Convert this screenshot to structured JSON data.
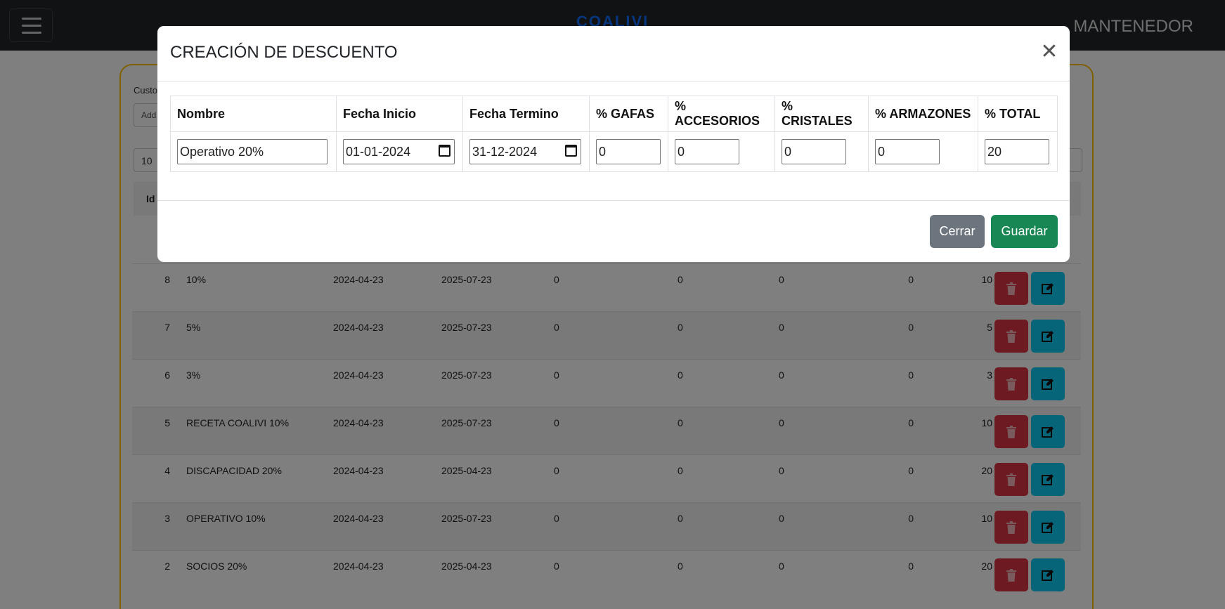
{
  "navbar": {
    "brand": "COALIVI",
    "right_label": "MANTENEDOR"
  },
  "card": {
    "label": "Custo",
    "add_label": "Add",
    "page_length": "10",
    "id_header": "Id"
  },
  "rows": [
    {
      "id": "8",
      "name": "10%",
      "inicio": "2024-04-23",
      "termino": "2025-07-23",
      "gafas": "0",
      "accesorios": "0",
      "cristales": "0",
      "armazones": "0",
      "total": "10"
    },
    {
      "id": "7",
      "name": "5%",
      "inicio": "2024-04-23",
      "termino": "2025-07-23",
      "gafas": "0",
      "accesorios": "0",
      "cristales": "0",
      "armazones": "0",
      "total": "5"
    },
    {
      "id": "6",
      "name": "3%",
      "inicio": "2024-04-23",
      "termino": "2025-07-23",
      "gafas": "0",
      "accesorios": "0",
      "cristales": "0",
      "armazones": "0",
      "total": "3"
    },
    {
      "id": "5",
      "name": "RECETA COALIVI 10%",
      "inicio": "2024-04-23",
      "termino": "2025-07-23",
      "gafas": "0",
      "accesorios": "0",
      "cristales": "0",
      "armazones": "0",
      "total": "10"
    },
    {
      "id": "4",
      "name": "DISCAPACIDAD 20%",
      "inicio": "2024-04-23",
      "termino": "2025-04-23",
      "gafas": "0",
      "accesorios": "0",
      "cristales": "0",
      "armazones": "0",
      "total": "20"
    },
    {
      "id": "3",
      "name": "OPERATIVO 10%",
      "inicio": "2024-04-23",
      "termino": "2025-07-23",
      "gafas": "0",
      "accesorios": "0",
      "cristales": "0",
      "armazones": "0",
      "total": "10"
    },
    {
      "id": "2",
      "name": "SOCIOS 20%",
      "inicio": "2024-04-23",
      "termino": "2025-04-23",
      "gafas": "0",
      "accesorios": "0",
      "cristales": "0",
      "armazones": "0",
      "total": "20"
    }
  ],
  "modal": {
    "title": "CREACIÓN DE DESCUENTO",
    "close_glyph": "✕",
    "headers": [
      "Nombre",
      "Fecha Inicio",
      "Fecha Termino",
      "% GAFAS",
      "% ACCESORIOS",
      "% CRISTALES",
      "% ARMAZONES",
      "% TOTAL"
    ],
    "values": {
      "nombre": "Operativo 20%",
      "fecha_inicio": "01-01-2024",
      "fecha_termino": "31-12-2024",
      "gafas": "0",
      "accesorios": "0",
      "cristales": "0",
      "armazones": "0",
      "total": "20"
    },
    "cerrar_label": "Cerrar",
    "guardar_label": "Guardar"
  },
  "icons": {
    "delete": "trash-icon",
    "edit": "edit-icon",
    "menu": "hamburger-icon",
    "calendar": "calendar-icon"
  }
}
